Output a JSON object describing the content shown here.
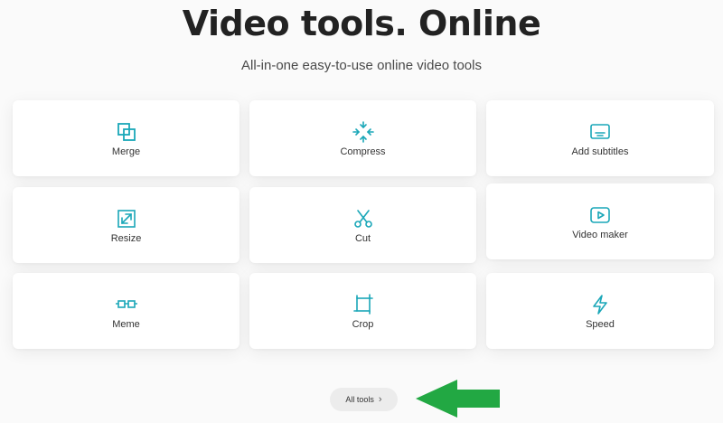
{
  "header": {
    "title": "Video tools. Online",
    "subtitle": "All-in-one easy-to-use online video tools"
  },
  "tools": [
    {
      "label": "Merge",
      "icon": "merge-icon"
    },
    {
      "label": "Compress",
      "icon": "compress-icon"
    },
    {
      "label": "Add subtitles",
      "icon": "subtitles-icon"
    },
    {
      "label": "Resize",
      "icon": "resize-icon"
    },
    {
      "label": "Cut",
      "icon": "scissors-icon"
    },
    {
      "label": "Video maker",
      "icon": "play-icon"
    },
    {
      "label": "Meme",
      "icon": "glasses-icon"
    },
    {
      "label": "Crop",
      "icon": "crop-icon"
    },
    {
      "label": "Speed",
      "icon": "lightning-icon"
    }
  ],
  "all_tools": {
    "label": "All tools",
    "icon": "chevron-right-icon"
  },
  "annotation": {
    "icon": "arrow-left-icon"
  },
  "colors": {
    "accent": "#1aa7b8",
    "arrow": "#22a843",
    "background": "#fafafa",
    "card": "#ffffff"
  }
}
